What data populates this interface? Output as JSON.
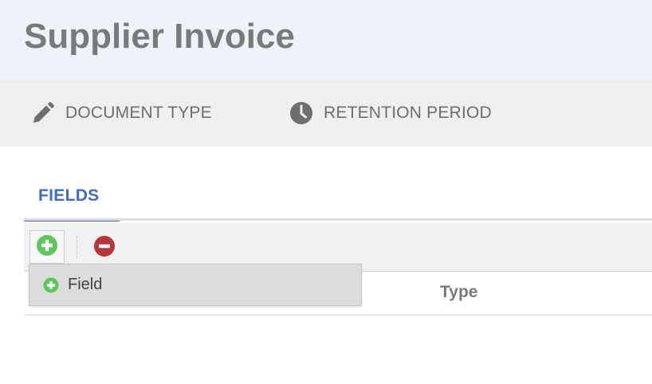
{
  "page": {
    "title": "Supplier Invoice"
  },
  "toolbar": {
    "document_type": {
      "label": "DOCUMENT TYPE",
      "icon": "pencil-icon"
    },
    "retention_period": {
      "label": "RETENTION PERIOD",
      "icon": "clock-icon"
    }
  },
  "tabs": [
    {
      "label": "FIELDS",
      "active": true
    }
  ],
  "grid": {
    "toolbar": {
      "add_icon": "plus-circle-icon",
      "remove_icon": "minus-circle-icon"
    },
    "columns": [
      "Type"
    ]
  },
  "add_menu": {
    "items": [
      {
        "label": "Field",
        "icon": "plus-circle-icon"
      }
    ]
  },
  "colors": {
    "accent": "#3f6cc2",
    "add_green": "#5cc85c",
    "remove_red": "#b8363a",
    "header_bg": "#eef3fa",
    "toolbar_bg": "#efefef"
  }
}
